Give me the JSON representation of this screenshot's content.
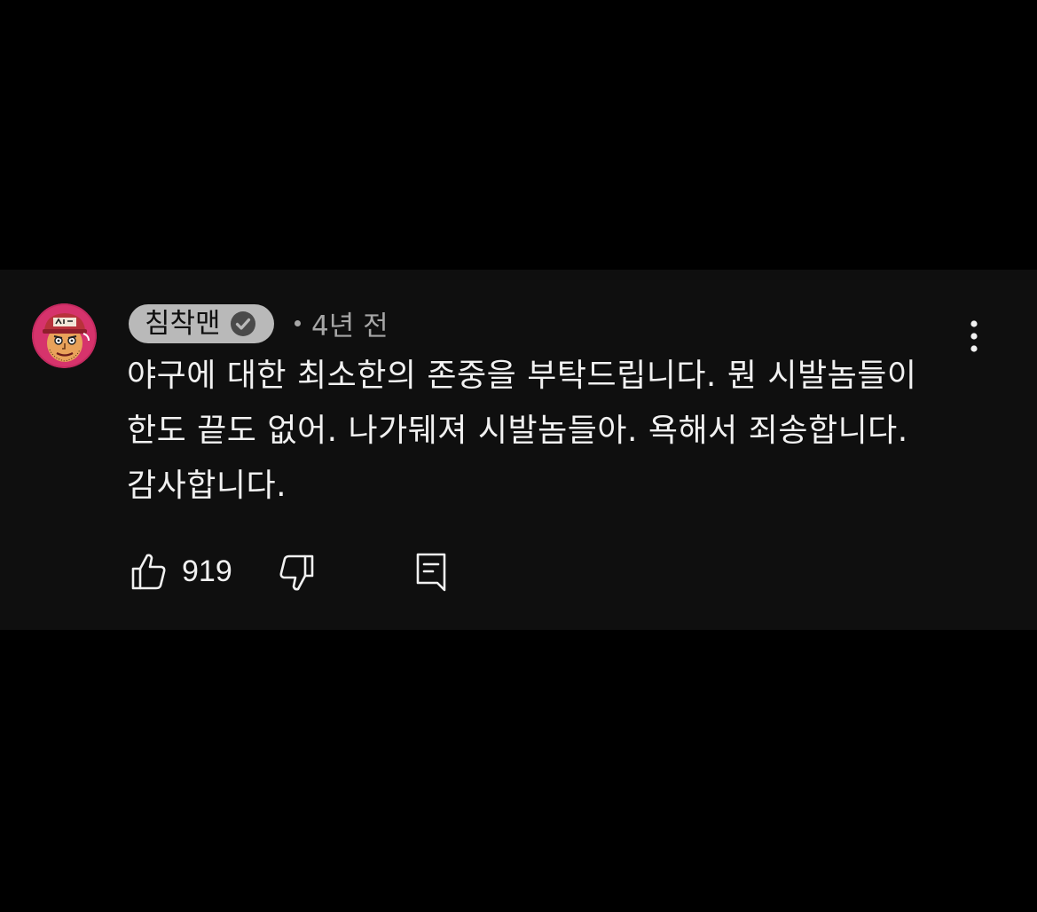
{
  "comment": {
    "author": "침착맨",
    "verified_icon": "check-circle-icon",
    "time_ago": "4년 전",
    "text": "야구에 대한 최소한의 존중을 부탁드립니다. 뭔 시발놈들이 한도 끝도 없어. 나가뒈져 시발놈들아. 욕해서 죄송합니다. 감사합니다.",
    "like_count": "919"
  },
  "icons": {
    "like": "thumbs-up-icon",
    "dislike": "thumbs-down-icon",
    "reply": "comment-reply-icon",
    "more": "vertical-ellipsis-icon"
  },
  "colors": {
    "background": "#000000",
    "panel": "#0f0f0f",
    "chip": "#b9b9b9",
    "text": "#f1f1f1",
    "meta": "#a6a6a6",
    "avatar_ring": "#d6336c"
  }
}
